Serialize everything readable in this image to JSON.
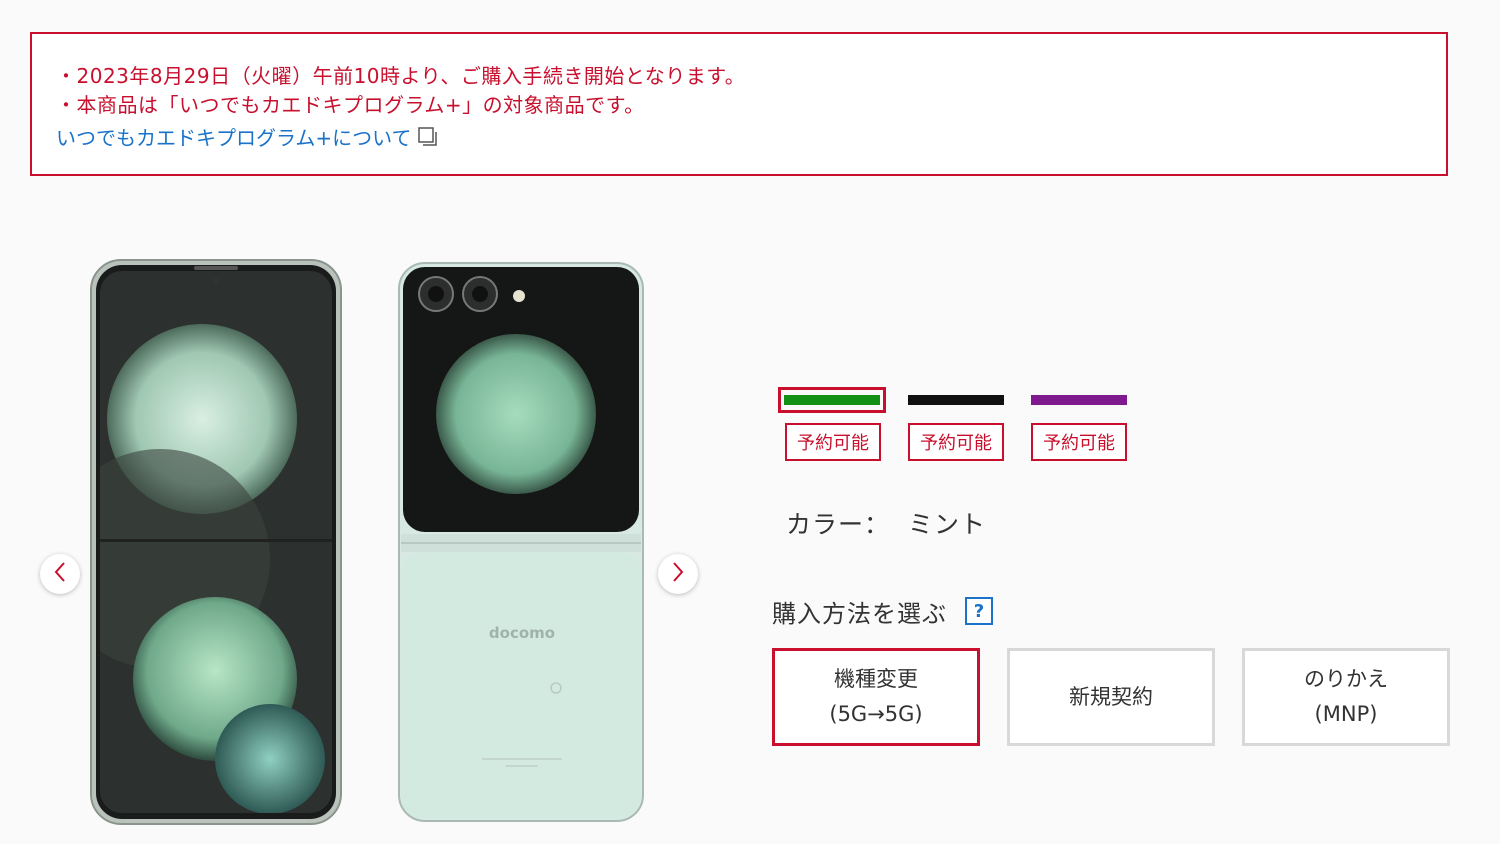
{
  "notice": {
    "line1": "・2023年8月29日（火曜）午前10時より、ご購入手続き開始となります。",
    "line2": "・本商品は「いつでもカエドキプログラム+」の対象商品です。",
    "link": "いつでもカエドキプログラム+について",
    "link_icon": "external-window-icon"
  },
  "carousel": {
    "prev_icon": "chevron-left-icon",
    "next_icon": "chevron-right-icon",
    "phone_brand": "docomo"
  },
  "colors": {
    "options": [
      {
        "swatch": "#149114",
        "status": "予約可能",
        "selected": true
      },
      {
        "swatch": "#111111",
        "status": "予約可能",
        "selected": false
      },
      {
        "swatch": "#7e1a8e",
        "status": "予約可能",
        "selected": false
      }
    ],
    "label": "カラー：",
    "value": "ミント"
  },
  "purchase": {
    "title": "購入方法を選ぶ",
    "help": "?",
    "methods": [
      {
        "line1": "機種変更",
        "line2": "(5G→5G)",
        "selected": true
      },
      {
        "line1": "新規契約",
        "line2": "",
        "selected": false
      },
      {
        "line1": "のりかえ",
        "line2": "(MNP)",
        "selected": false
      }
    ]
  },
  "theme": {
    "accent": "#c8102e",
    "link": "#1a73c9"
  }
}
